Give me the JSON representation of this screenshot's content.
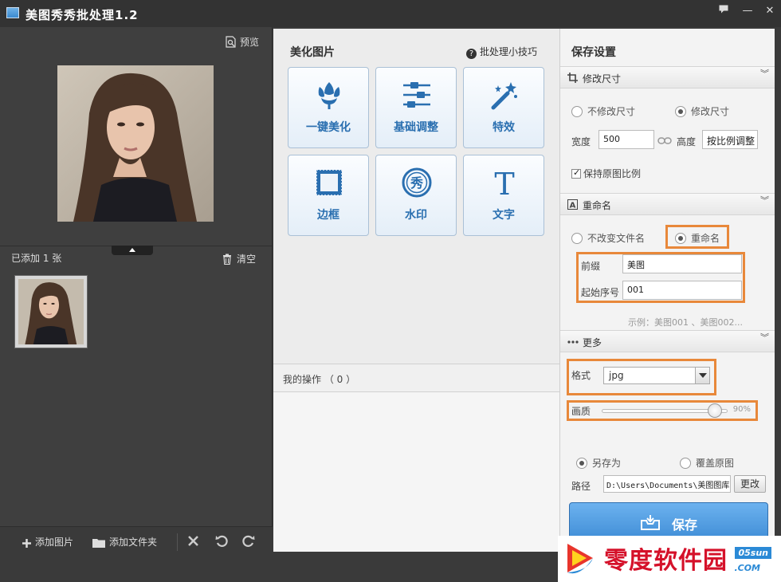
{
  "window": {
    "title": "美图秀秀批处理1.2",
    "feedback_icon": "feedback-icon",
    "minimize": "—",
    "close": "✕"
  },
  "left": {
    "preview_label": "预览",
    "added_label": "已添加 1 张",
    "clear_label": "清空",
    "bottom": {
      "add_image": "添加图片",
      "add_folder": "添加文件夹"
    }
  },
  "center": {
    "heading": "美化图片",
    "tips": "批处理小技巧",
    "tools": [
      {
        "label": "一键美化",
        "icon": "tulip-icon"
      },
      {
        "label": "基础调整",
        "icon": "sliders-icon"
      },
      {
        "label": "特效",
        "icon": "magic-wand-icon"
      },
      {
        "label": "边框",
        "icon": "frame-icon"
      },
      {
        "label": "水印",
        "icon": "watermark-icon"
      },
      {
        "label": "文字",
        "icon": "text-icon"
      }
    ],
    "ops_label": "我的操作 （ 0 ）"
  },
  "right": {
    "title": "保存设置",
    "resize": {
      "header": "修改尺寸",
      "opt_keep": "不修改尺寸",
      "opt_resize": "修改尺寸",
      "width_label": "宽度",
      "width_value": "500",
      "height_label": "高度",
      "height_value": "按比例调整",
      "keep_ratio": "保持原图比例"
    },
    "rename": {
      "header": "重命名",
      "opt_keep": "不改变文件名",
      "opt_rename": "重命名",
      "prefix_label": "前缀",
      "prefix_value": "美图",
      "start_label": "起始序号",
      "start_value": "001",
      "example": "示例：美图001 、美图002..."
    },
    "more": {
      "header": "更多",
      "format_label": "格式",
      "format_value": "jpg",
      "quality_label": "画质",
      "quality_value": "90%",
      "quality_fraction": 0.9,
      "save_as": "另存为",
      "overwrite": "覆盖原图",
      "path_label": "路径",
      "path_value": "D:\\Users\\Documents\\美图图库",
      "change_btn": "更改",
      "save_btn": "保存"
    }
  },
  "watermark": {
    "text": "零度软件园",
    "badge": "05sun",
    "domain": ".COM"
  },
  "colors": {
    "accent": "#2a6fb0",
    "highlight": "#e8883a",
    "save": "#3f8fd8"
  }
}
